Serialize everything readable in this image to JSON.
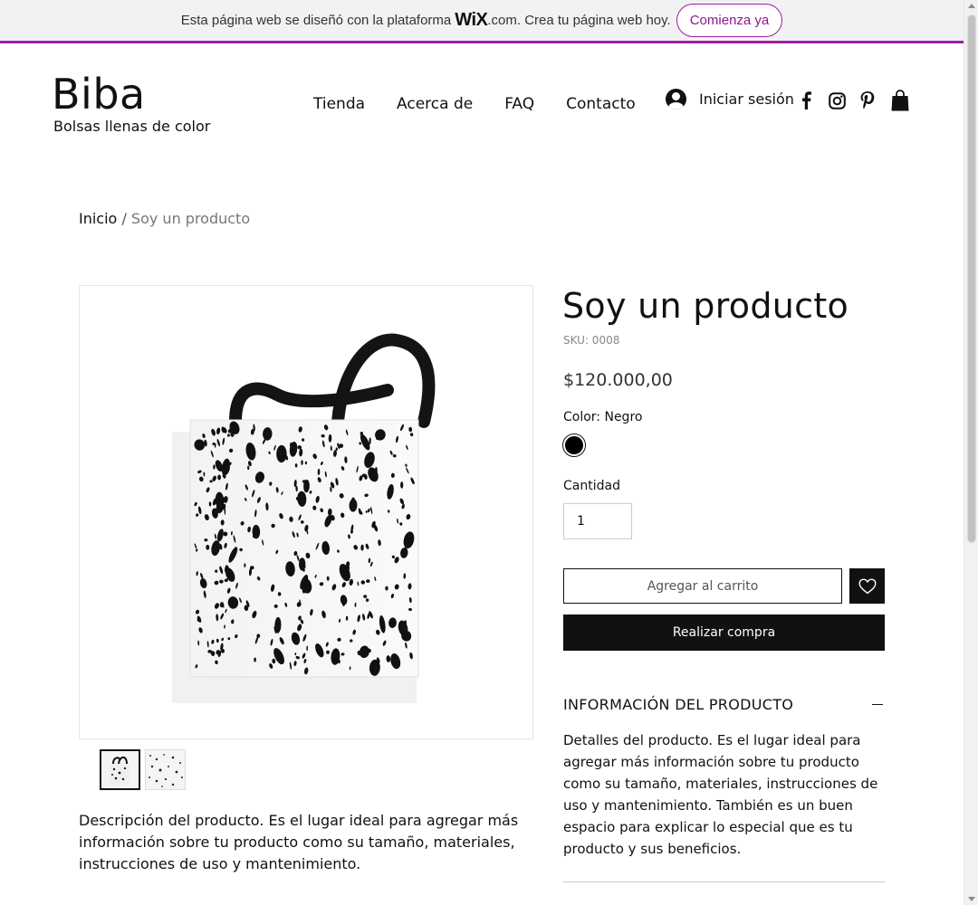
{
  "wix_banner": {
    "text_before": "Esta página web se diseñó con la plataforma",
    "logo": "WiX",
    "text_after": ".com. Crea tu página web hoy.",
    "cta": "Comienza ya",
    "accent_color": "#9c1fa0"
  },
  "header": {
    "brand_name": "Biba",
    "tagline": "Bolsas llenas de color",
    "nav": [
      "Tienda",
      "Acerca de",
      "FAQ",
      "Contacto"
    ],
    "login_label": "Iniciar sesión",
    "social_icons": [
      "facebook-icon",
      "instagram-icon",
      "pinterest-icon"
    ],
    "cart_icon": "shopping-bag-icon"
  },
  "breadcrumb": {
    "home": "Inicio",
    "separator": "/",
    "current": "Soy un producto"
  },
  "product": {
    "title": "Soy un producto",
    "sku": "SKU: 0008",
    "price": "$120.000,00",
    "color_label": "Color: Negro",
    "selected_color": "#000000",
    "quantity_label": "Cantidad",
    "quantity_value": "1",
    "add_to_cart": "Agregar al carrito",
    "buy_now": "Realizar compra",
    "description": "Descripción del producto. Es el lugar ideal para agregar más información sobre tu producto como su tamaño, materiales, instrucciones de uso y mantenimiento.",
    "info_title": "INFORMACIÓN DEL PRODUCTO",
    "info_text": "Detalles del producto. Es el lugar ideal para agregar más información sobre tu producto como su tamaño, materiales, instrucciones de uso y mantenimiento. También es un buen espacio para explicar lo especial que es tu producto y sus beneficios.",
    "thumbnails": [
      "tote-bag-thumbnail",
      "pattern-thumbnail"
    ]
  }
}
